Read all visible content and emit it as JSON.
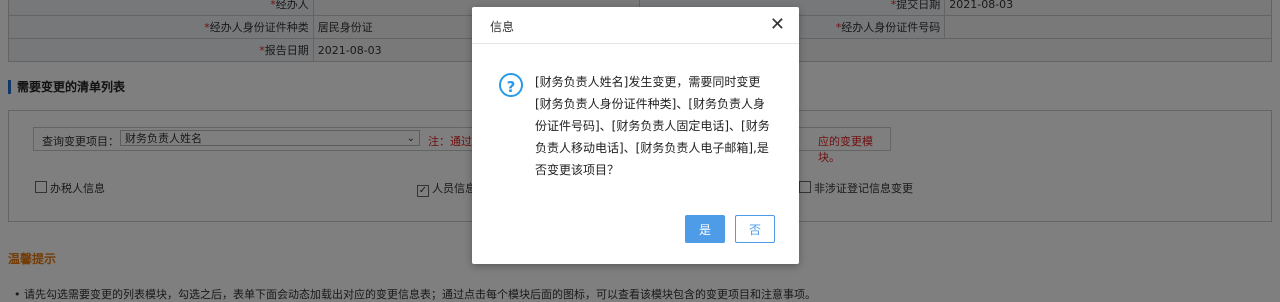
{
  "form": {
    "row0": {
      "label_left": "经办人",
      "label_right": "提交日期",
      "value_right": "2021-08-03"
    },
    "row1": {
      "label_left": "经办人身份证件种类",
      "value_left": "居民身份证",
      "label_right": "经办人身份证件号码",
      "value_right": ""
    },
    "row2": {
      "label_left": "报告日期",
      "value_left": "2021-08-03"
    }
  },
  "section": {
    "title": "需要变更的清单列表"
  },
  "query": {
    "label": "查询变更项目：",
    "selected": "财务负责人姓名",
    "note": "注：通过变更项",
    "note2": "应的变更模块。"
  },
  "checkboxes": [
    {
      "label": "办税人信息",
      "checked": false
    },
    {
      "label": "人员信息",
      "checked": true
    },
    {
      "label": "非涉证登记信息变更",
      "checked": false
    }
  ],
  "tips": {
    "title": "温馨提示",
    "text": "• 请先勾选需要变更的列表模块，勾选之后，表单下面会动态加载出对应的变更信息表；通过点击每个模块后面的图标，可以查看该模块包含的变更项目和注意事项。"
  },
  "dialog": {
    "title": "信息",
    "close": "✕",
    "icon": "?",
    "message": "[财务负责人姓名]发生变更，需要同时变更[财务负责人身份证件种类]、[财务负责人身份证件号码]、[财务负责人固定电话]、[财务负责人移动电话]、[财务负责人电子邮箱],是否变更该项目？",
    "yes": "是",
    "no": "否"
  },
  "colors": {
    "accent": "#4e9be8",
    "required": "#e02020",
    "tips": "#e87a0e"
  }
}
